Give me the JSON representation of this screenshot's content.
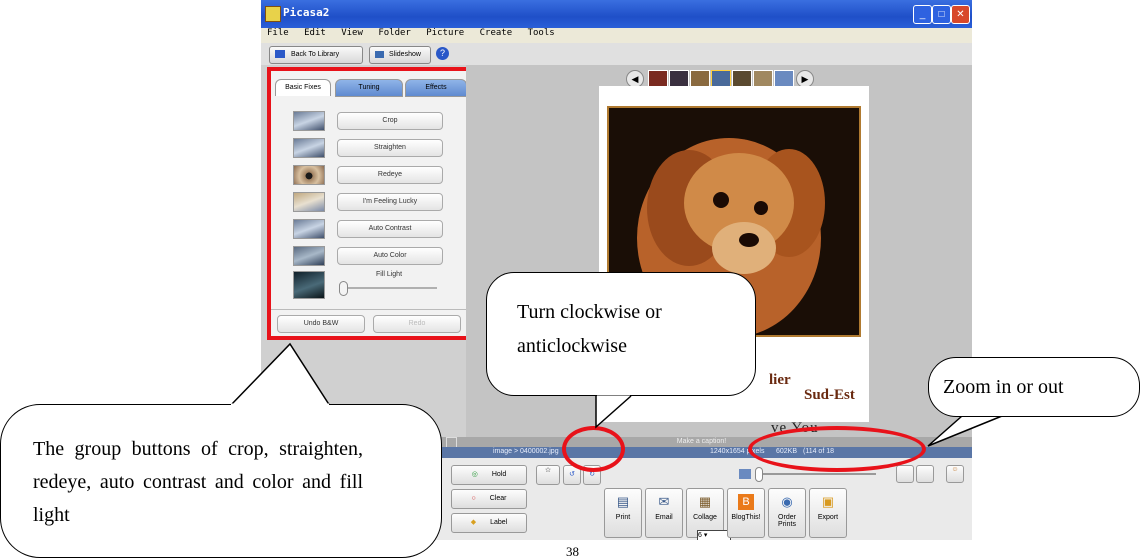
{
  "window": {
    "title": "Picasa2"
  },
  "menu": [
    "File",
    "Edit",
    "View",
    "Folder",
    "Picture",
    "Create",
    "Tools"
  ],
  "toolbar": {
    "back": "Back To Library",
    "slideshow": "Slideshow"
  },
  "tabs": [
    "Basic Fixes",
    "Tuning",
    "Effects"
  ],
  "fixes": [
    "Crop",
    "Straighten",
    "Redeye",
    "I'm Feeling Lucky",
    "Auto Contrast",
    "Auto Color"
  ],
  "fill_light": "Fill Light",
  "undo": "Undo B&W",
  "redo": "Redo",
  "photo_text": {
    "line1": "lier",
    "line2": "Sud-Est",
    "line3": "ve You"
  },
  "caption_placeholder": "Make a caption!",
  "status": {
    "file": "image > 0400002.jpg",
    "dims": "1240x1654 pixels",
    "size": "602KB",
    "count": "(114 of 18"
  },
  "tray": {
    "hold": "Hold",
    "clear": "Clear",
    "label": "Label"
  },
  "actions": [
    "Print",
    "Email",
    "Collage",
    "BlogThis!",
    "Order Prints",
    "Export"
  ],
  "collage_counter": "6",
  "callouts": {
    "rotate": "Turn clockwise or anticlockwise",
    "zoom": "Zoom in or out",
    "group": "The group buttons of crop, straighten, redeye, auto contrast and color and fill light"
  },
  "page_number": "38",
  "colors": {
    "highlight": "#e8121a",
    "titlebar": "#1f4fc8"
  }
}
